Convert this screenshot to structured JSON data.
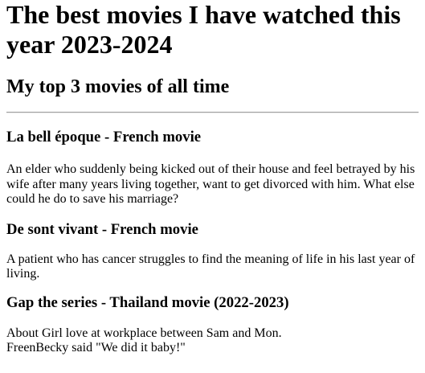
{
  "page": {
    "title": "The best movies I have watched this year 2023-2024",
    "subtitle": "My top 3 movies of all time"
  },
  "movies": [
    {
      "heading": "La bell époque - French movie",
      "description": "An elder who suddenly being kicked out of their house and feel betrayed by his wife after many years living together, want to get divorced with him. What else could he do to save his marriage?"
    },
    {
      "heading": "De sont vivant - French movie",
      "description": "A patient who has cancer struggles to find the meaning of life in his last year of living."
    },
    {
      "heading": "Gap the series - Thailand movie (2022-2023)",
      "description_lines": [
        "About Girl love at workplace between Sam and Mon.",
        "FreenBecky said \"We did it baby!\""
      ]
    }
  ]
}
